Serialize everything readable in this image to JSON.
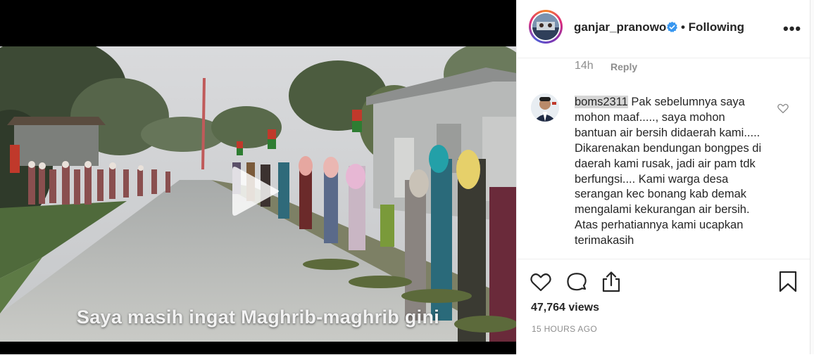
{
  "video": {
    "caption": "Saya masih ingat Maghrib-maghrib gini"
  },
  "post": {
    "username": "ganjar_pranowo",
    "follow_status": "• Following",
    "more_label": "•••"
  },
  "comments": {
    "previous_time": "14h",
    "previous_reply": "Reply",
    "item": {
      "username": "boms2311",
      "text": " Pak sebelumnya saya mohon maaf....., saya mohon bantuan air bersih didaerah kami..... Dikarenakan bendungan bongpes di daerah kami rusak, jadi air pam tdk berfungsi.... Kami warga desa serangan kec bonang kab demak mengalami kekurangan air bersih. Atas perhatiannya kami ucapkan terimakasih"
    }
  },
  "stats": {
    "views": "47,764 views",
    "posted": "15 HOURS AGO"
  },
  "colors": {
    "text": "#262626",
    "muted": "#8e8e8e",
    "verified": "#3897f0",
    "border": "#efefef"
  },
  "icons": [
    "verified-badge-icon",
    "more-options-icon",
    "heart-icon",
    "comment-icon",
    "share-icon",
    "bookmark-icon",
    "play-icon"
  ]
}
